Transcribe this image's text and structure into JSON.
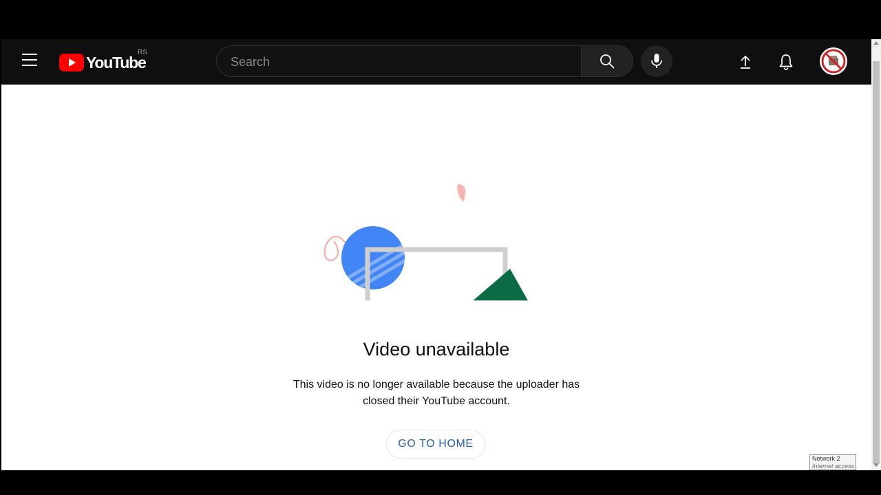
{
  "masthead": {
    "logo_text": "YouTube",
    "country_code": "RS",
    "search_placeholder": "Search"
  },
  "error": {
    "title": "Video unavailable",
    "message_line1": "This video is no longer available because the uploader has",
    "message_line2": "closed their YouTube account.",
    "home_button": "GO TO HOME"
  },
  "system_tooltip": {
    "line1": "Network  2",
    "line2": "Internet access"
  },
  "colors": {
    "masthead_bg": "#0f0f0f",
    "youtube_red": "#ff0000",
    "link_blue": "#2a5da8",
    "illustration_blue": "#4285f4",
    "illustration_green": "#0b6b45",
    "illustration_pink": "#f4b5b5"
  }
}
